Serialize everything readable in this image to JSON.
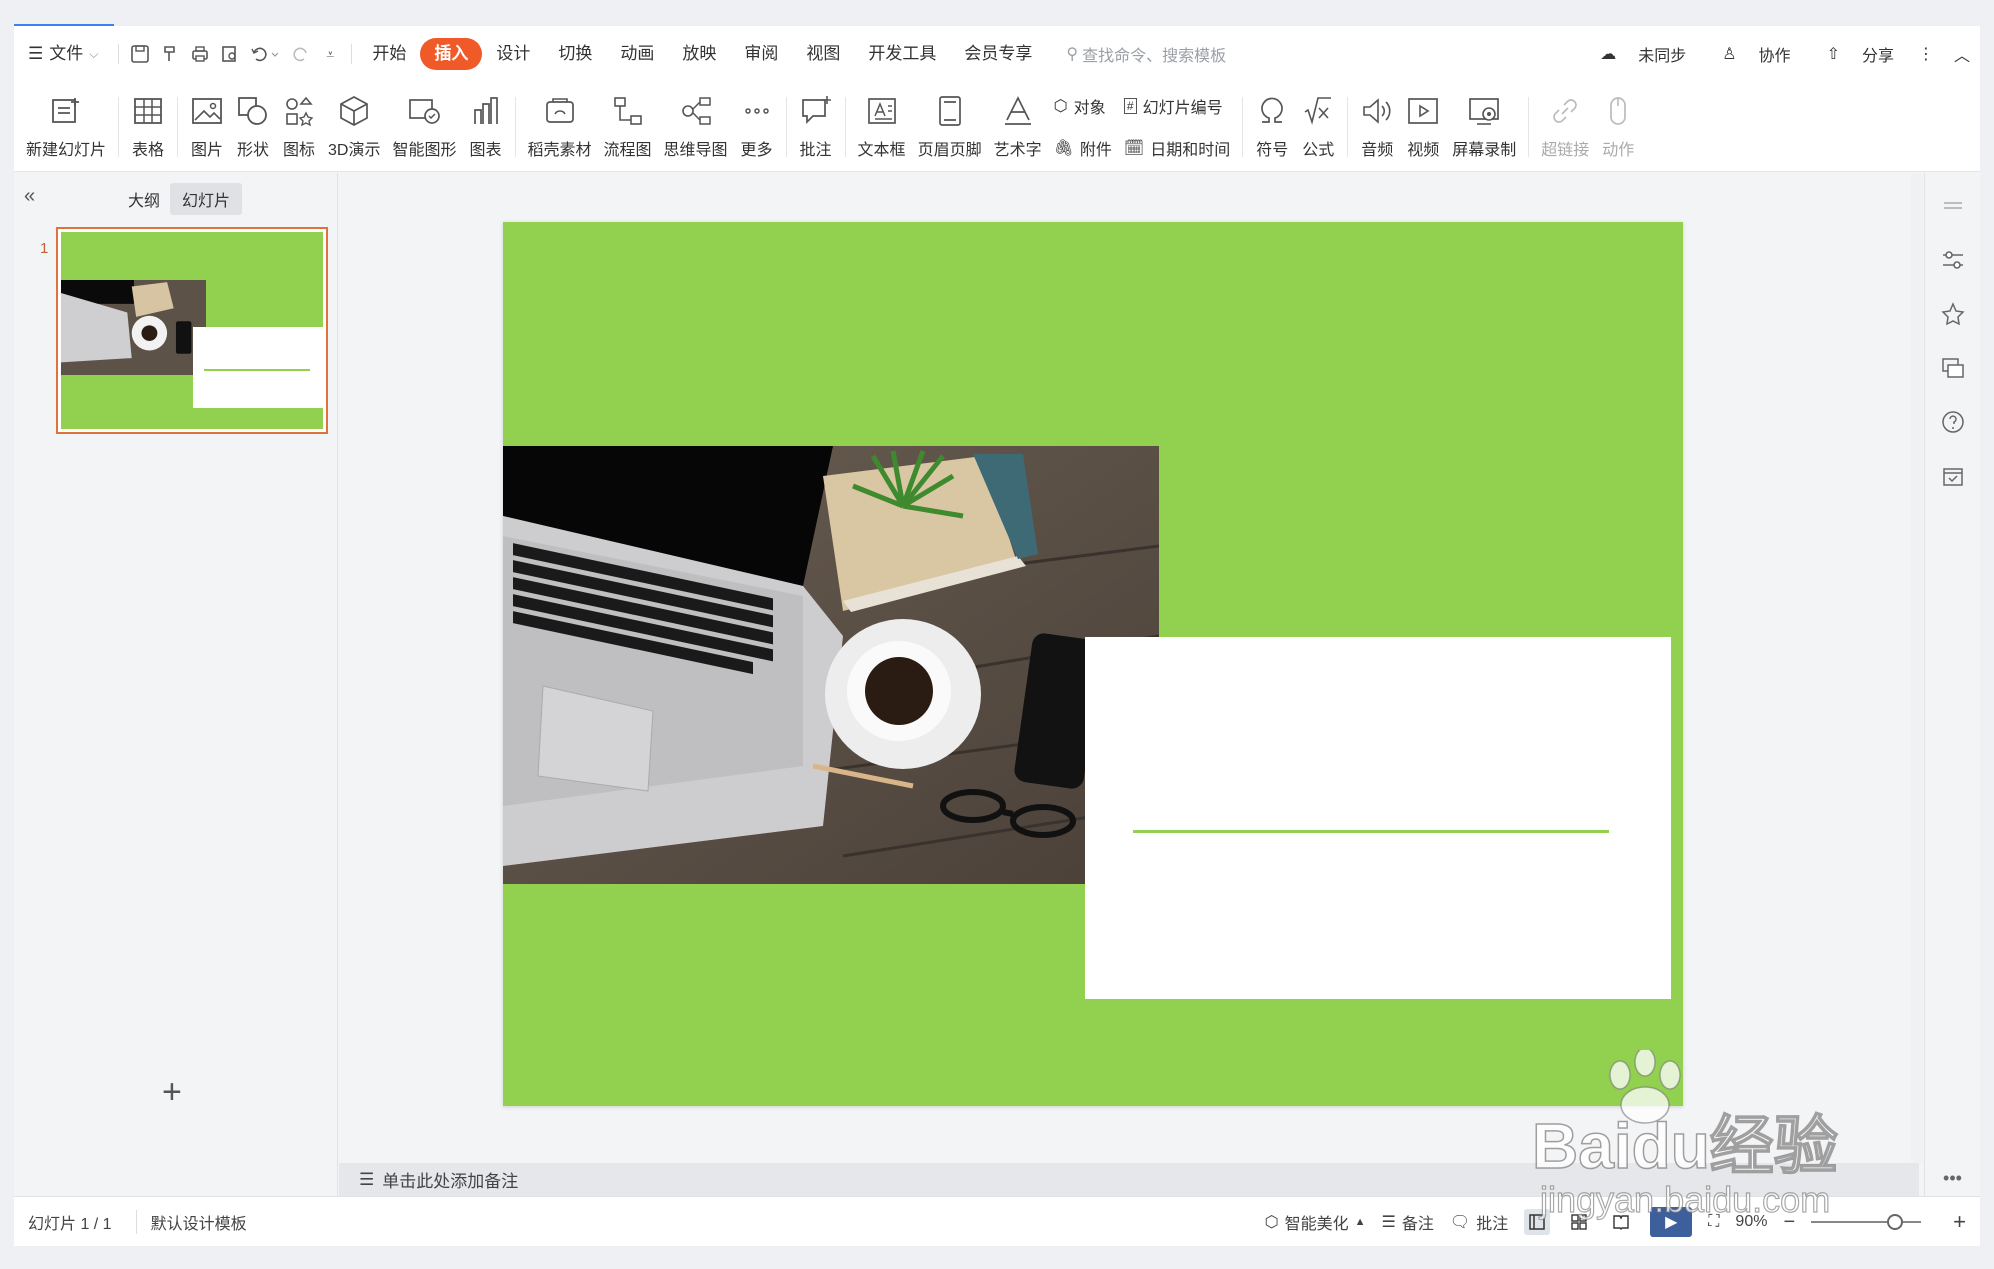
{
  "menu": {
    "file": "文件",
    "tabs": [
      "开始",
      "插入",
      "设计",
      "切换",
      "动画",
      "放映",
      "审阅",
      "视图",
      "开发工具",
      "会员专享"
    ],
    "active_tab": "插入",
    "search_placeholder": "查找命令、搜索模板",
    "sync": "未同步",
    "collab": "协作",
    "share": "分享"
  },
  "ribbon": {
    "new_slide": "新建幻灯片",
    "table": "表格",
    "picture": "图片",
    "shape": "形状",
    "icon": "图标",
    "threed": "3D演示",
    "smartart": "智能图形",
    "chart": "图表",
    "docer": "稻壳素材",
    "flowchart": "流程图",
    "mindmap": "思维导图",
    "more": "更多",
    "comment": "批注",
    "textbox": "文本框",
    "header_footer": "页眉页脚",
    "wordart": "艺术字",
    "object": "对象",
    "slide_number": "幻灯片编号",
    "attachment": "附件",
    "datetime": "日期和时间",
    "symbol": "符号",
    "formula": "公式",
    "audio": "音频",
    "video": "视频",
    "screen_record": "屏幕录制",
    "hyperlink": "超链接",
    "action": "动作"
  },
  "left_panel": {
    "outline_tab": "大纲",
    "slides_tab": "幻灯片",
    "slide_number": "1"
  },
  "notes_placeholder": "单击此处添加备注",
  "status": {
    "slide_info": "幻灯片 1 / 1",
    "template": "默认设计模板",
    "beautify": "智能美化",
    "notes": "备注",
    "comments": "批注",
    "zoom": "90%"
  },
  "colors": {
    "slide_bg": "#92d050",
    "accent": "#f05a28"
  },
  "watermark": {
    "brand": "Baidu经验",
    "url": "jingyan.baidu.com"
  }
}
